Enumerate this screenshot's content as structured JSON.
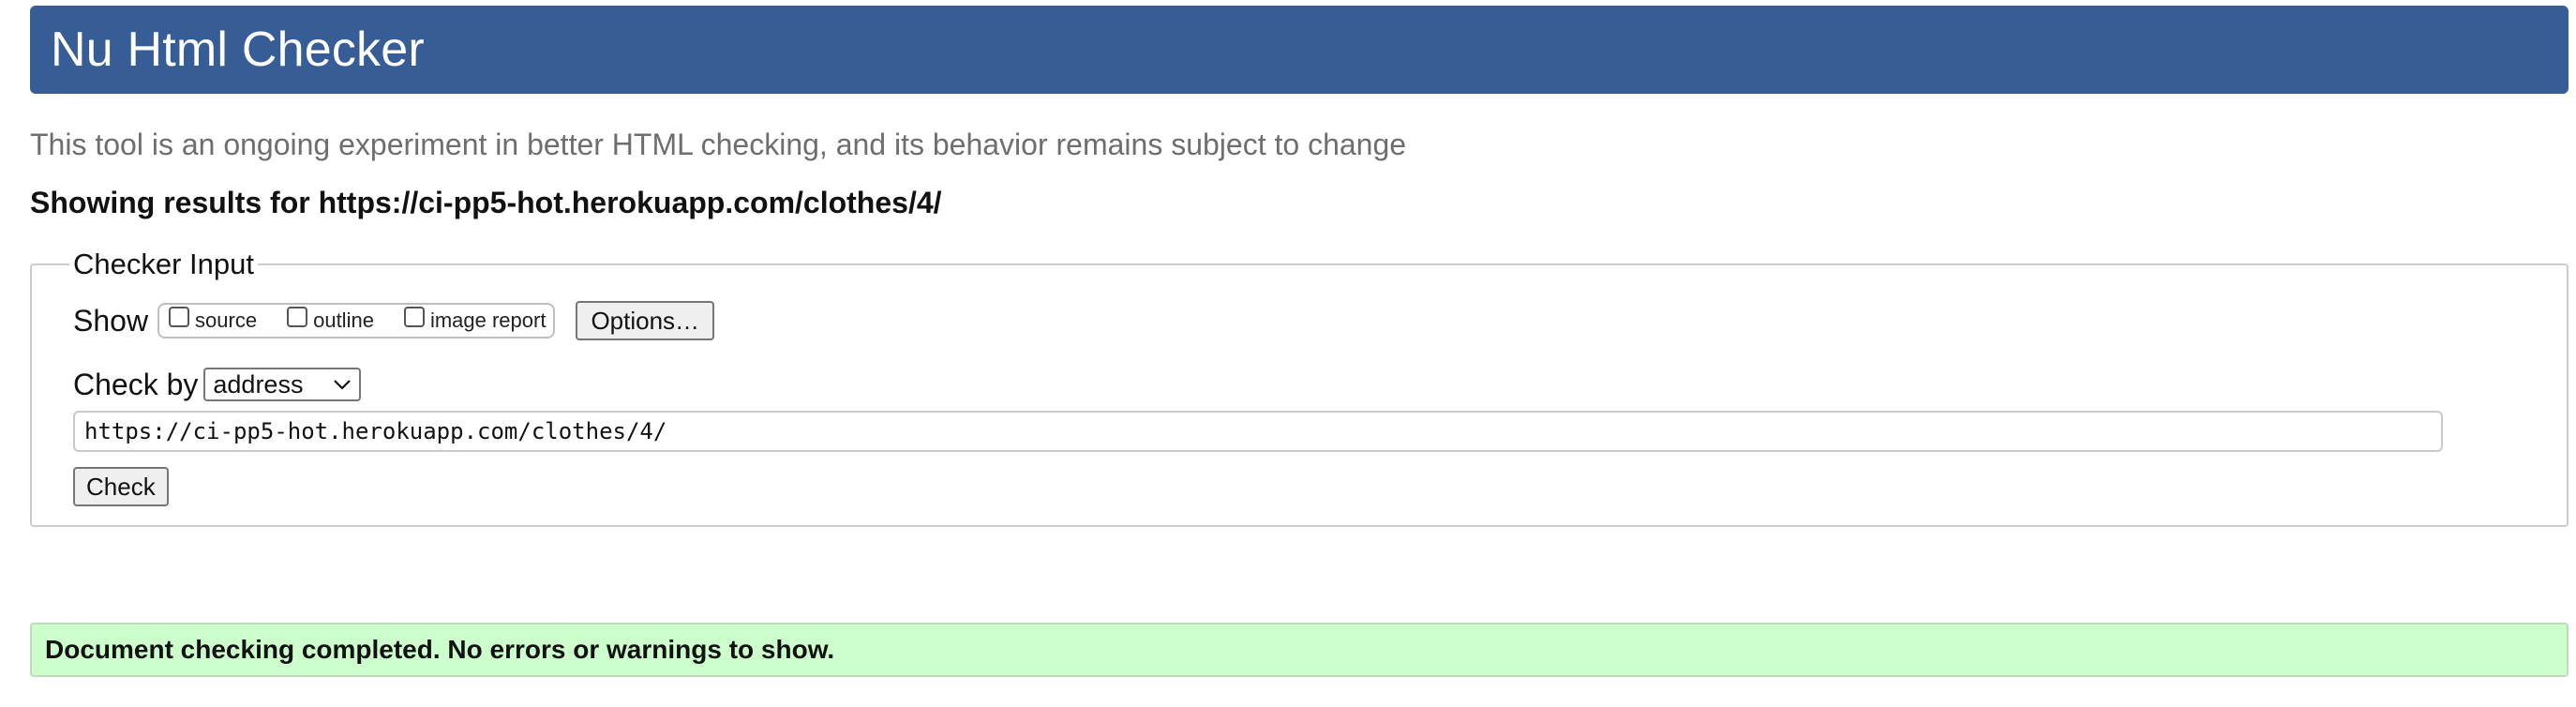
{
  "header": {
    "title": "Nu Html Checker"
  },
  "tagline": "This tool is an ongoing experiment in better HTML checking, and its behavior remains subject to change",
  "results_heading": "Showing results for https://ci-pp5-hot.herokuapp.com/clothes/4/",
  "checker_input": {
    "legend": "Checker Input",
    "show_label": "Show",
    "show_options": [
      {
        "label": "source",
        "checked": false
      },
      {
        "label": "outline",
        "checked": false
      },
      {
        "label": "image report",
        "checked": false
      }
    ],
    "options_button": "Options…",
    "check_by_label": "Check by",
    "check_by_selected": "address",
    "url_value": "https://ci-pp5-hot.herokuapp.com/clothes/4/",
    "check_button": "Check"
  },
  "status_message": "Document checking completed. No errors or warnings to show.",
  "colors": {
    "header_bg": "#365d95",
    "success_bg": "#ccffcc"
  },
  "icons": {
    "select_arrow": "chevron-down-icon"
  }
}
